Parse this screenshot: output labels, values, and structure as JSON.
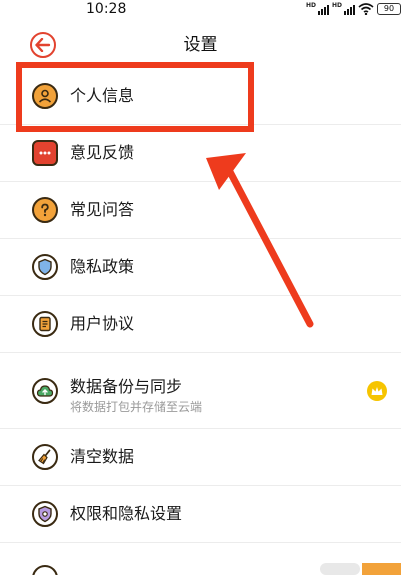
{
  "status_bar": {
    "time": "10:28",
    "signal1_label": "HD",
    "signal2_label": "HD",
    "wifi_icon": "wifi-icon",
    "battery": "90"
  },
  "header": {
    "back_icon": "arrow-left-icon",
    "title": "设置"
  },
  "settings": [
    {
      "label": "个人信息",
      "icon": "person-icon"
    },
    {
      "label": "意见反馈",
      "icon": "feedback-icon"
    },
    {
      "label": "常见问答",
      "icon": "question-icon"
    },
    {
      "label": "隐私政策",
      "icon": "shield-icon"
    },
    {
      "label": "用户协议",
      "icon": "document-icon"
    },
    {
      "label": "数据备份与同步",
      "sublabel": "将数据打包并存储至云端",
      "icon": "cloud-upload-icon",
      "badge_icon": "crown-icon"
    },
    {
      "label": "清空数据",
      "icon": "broom-icon"
    },
    {
      "label": "权限和隐私设置",
      "icon": "privacy-settings-icon"
    }
  ],
  "chevron_glyph": "›",
  "colors": {
    "accent_red": "#e2432f",
    "annotation_red": "#ee3b1d",
    "icon_fill_orange": "#f2a23a",
    "icon_fill_blue": "#7fb3e8",
    "icon_fill_green": "#4aa864",
    "badge_yellow": "#f6c400"
  }
}
